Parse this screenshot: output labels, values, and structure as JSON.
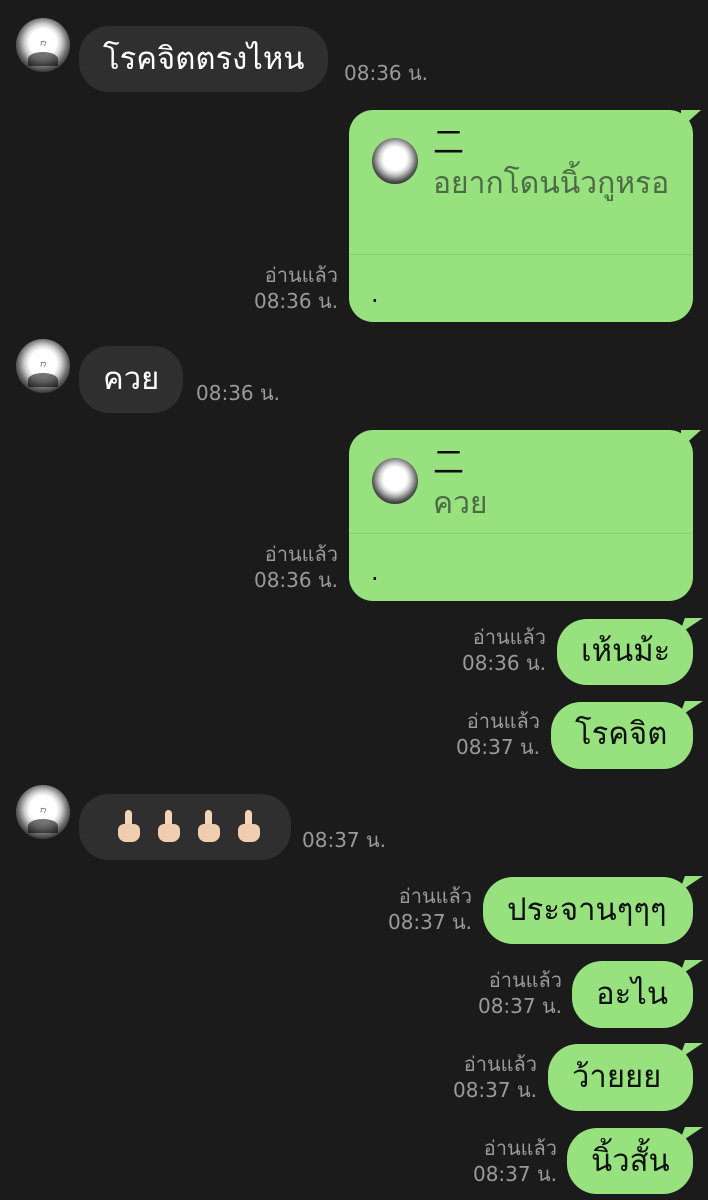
{
  "messages": [
    {
      "type": "in",
      "text": "โรคจิตตรงไหน",
      "time": "08:36 น."
    },
    {
      "type": "reply",
      "quote_name": "二",
      "quote_text": "อยากโดนนิ้วกูหรอ",
      "body": ".",
      "read": "อ่านแล้ว",
      "time": "08:36 น."
    },
    {
      "type": "in",
      "text": "ควย",
      "time": "08:36 น."
    },
    {
      "type": "reply",
      "quote_name": "二",
      "quote_text": "ควย",
      "body": ".",
      "read": "อ่านแล้ว",
      "time": "08:36 น."
    },
    {
      "type": "out",
      "text": "เห้นม้ะ",
      "read": "อ่านแล้ว",
      "time": "08:36 น."
    },
    {
      "type": "out",
      "text": "โรคจิต",
      "read": "อ่านแล้ว",
      "time": "08:37 น."
    },
    {
      "type": "in",
      "text": "🖕🖕🖕🖕",
      "time": "08:37 น."
    },
    {
      "type": "out",
      "text": "ประจานๆๆๆ",
      "read": "อ่านแล้ว",
      "time": "08:37 น."
    },
    {
      "type": "out",
      "text": "อะไน",
      "read": "อ่านแล้ว",
      "time": "08:37 น."
    },
    {
      "type": "out",
      "text": "ว้ายยย",
      "read": "อ่านแล้ว",
      "time": "08:37 น."
    },
    {
      "type": "out",
      "text": "นิ้วสั้น",
      "read": "อ่านแล้ว",
      "time": "08:37 น."
    }
  ],
  "colors": {
    "background": "#1b1b1b",
    "incoming": "#2f2f2f",
    "outgoing": "#97e27f",
    "meta": "#9a9a9a"
  },
  "icons": {
    "avatar": "profile-avatar",
    "middle_finger": "middle-finger-emoji"
  }
}
